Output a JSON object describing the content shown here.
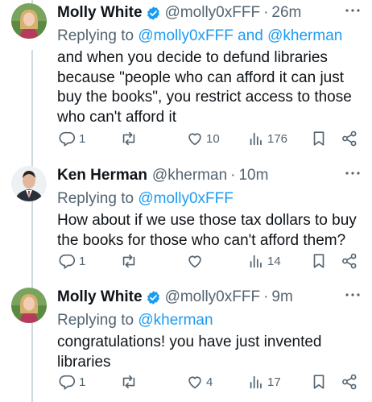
{
  "posts": [
    {
      "author_name": "Molly White",
      "author_handle": "@molly0xFFF",
      "separator": "·",
      "time": "26m",
      "replying_prefix": "Replying to ",
      "replying_to": [
        "@molly0xFFF",
        "@kherman"
      ],
      "replying_joiner": " and ",
      "text": "and when you decide to defund libraries because \"people who can afford it can just buy the books\", you restrict access to those who can't afford it",
      "stats": {
        "replies": "1",
        "reposts": "",
        "likes": "10",
        "views": "176"
      }
    },
    {
      "author_name": "Ken Herman",
      "author_handle": "@kherman",
      "separator": "·",
      "time": "10m",
      "replying_prefix": "Replying to ",
      "replying_to": [
        "@molly0xFFF"
      ],
      "text": "How about if we use those tax dollars to buy the books for those who can't afford them?",
      "stats": {
        "replies": "1",
        "reposts": "",
        "likes": "",
        "views": "14"
      }
    },
    {
      "author_name": "Molly White",
      "author_handle": "@molly0xFFF",
      "separator": "·",
      "time": "9m",
      "replying_prefix": "Replying to ",
      "replying_to": [
        "@kherman"
      ],
      "text": "congratulations! you have just invented libraries",
      "stats": {
        "replies": "1",
        "reposts": "",
        "likes": "4",
        "views": "17"
      }
    }
  ],
  "colors": {
    "link": "#1d9bf0",
    "secondary_text": "#536471",
    "primary_text": "#0f1419",
    "verified_badge": "#1d9bf0",
    "thread_line": "#cfd9de"
  },
  "icons": {
    "reply": "reply-icon",
    "repost": "repost-icon",
    "like": "heart-icon",
    "views": "views-icon",
    "bookmark": "bookmark-icon",
    "share": "share-icon",
    "more": "more-icon",
    "verified": "verified-badge-icon"
  }
}
